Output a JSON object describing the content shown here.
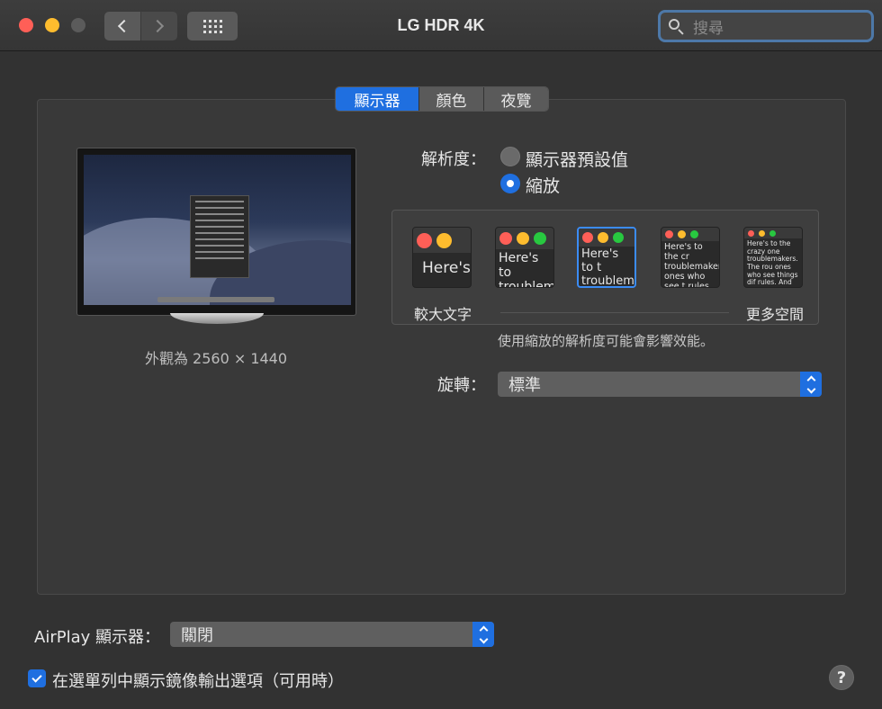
{
  "window": {
    "title": "LG HDR 4K"
  },
  "search": {
    "placeholder": "搜尋"
  },
  "tabs": [
    {
      "label": "顯示器",
      "selected": true
    },
    {
      "label": "顏色",
      "selected": false
    },
    {
      "label": "夜覽",
      "selected": false
    }
  ],
  "monitor": {
    "caption": "外觀為 2560 × 1440"
  },
  "resolution": {
    "label": "解析度：",
    "options": [
      {
        "label": "顯示器預設值",
        "selected": false
      },
      {
        "label": "縮放",
        "selected": true
      }
    ]
  },
  "scaling": {
    "previews": [
      {
        "text": "Here's"
      },
      {
        "text": "Here's to troublem"
      },
      {
        "text": "Here's to t troublema ones who"
      },
      {
        "text": "Here's to the cr troublemakers. ones who see t rules. And they"
      },
      {
        "text": "Here's to the crazy one troublemakers. The rou ones who see things dif rules. And they have no can quote them, disagre them. About the only th Because they change t"
      }
    ],
    "selected_index": 2,
    "left_label": "較大文字",
    "right_label": "更多空間",
    "note": "使用縮放的解析度可能會影響效能。"
  },
  "rotation": {
    "label": "旋轉：",
    "value": "標準"
  },
  "airplay": {
    "label": "AirPlay 顯示器：",
    "value": "關閉"
  },
  "mirror_option": {
    "label": "在選單列中顯示鏡像輸出選項（可用時）",
    "checked": true
  },
  "help": {
    "label": "?"
  },
  "colors": {
    "accent": "#1f6fe0",
    "close": "#ff5f57",
    "minimize": "#febc2e",
    "zoom": "#28c840"
  }
}
